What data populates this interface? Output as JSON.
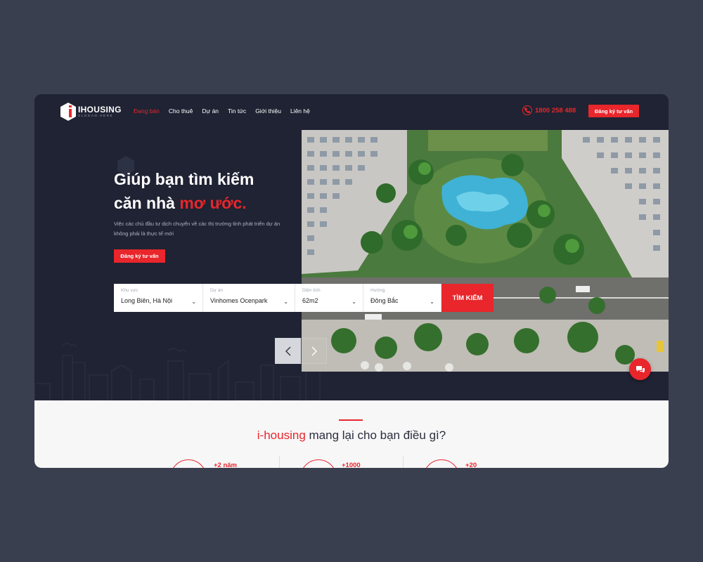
{
  "header": {
    "logo": {
      "name": "IHOUSING",
      "slogan": "SLOGAN HERE"
    },
    "nav": [
      {
        "label": "Đang bán",
        "active": true
      },
      {
        "label": "Cho thuê",
        "active": false
      },
      {
        "label": "Dự án",
        "active": false
      },
      {
        "label": "Tin tức",
        "active": false
      },
      {
        "label": "Giới thiệu",
        "active": false
      },
      {
        "label": "Liên hệ",
        "active": false
      }
    ],
    "phone": "1800 258 488",
    "cta_label": "Đăng ký tư vấn"
  },
  "hero": {
    "title_line1": "Giúp bạn tìm kiếm",
    "title_line2_prefix": "căn nhà ",
    "title_line2_accent": "mơ ước.",
    "description": "Việc các chủ đầu tư dịch chuyển về các thị trường tỉnh phát triển dự án không phải là thực tế mới",
    "cta_label": "Đăng ký tư vấn"
  },
  "search": {
    "fields": [
      {
        "label": "Khu vực",
        "value": "Long Biên, Hà Nội"
      },
      {
        "label": "Dự án",
        "value": "Vinhomes Ocenpark"
      },
      {
        "label": "Diện tích",
        "value": "62m2"
      },
      {
        "label": "Hướng",
        "value": "Đông Bắc"
      }
    ],
    "button_label": "TÌM KIẾM"
  },
  "section": {
    "title_brand": "i-housing",
    "title_rest": " mang lại cho bạn điều gì?",
    "stats": [
      "+2 năm",
      "+1000",
      "+20"
    ]
  },
  "colors": {
    "accent": "#e8262b",
    "dark_bg": "#1f2333",
    "outer_bg": "#3a3f4f"
  },
  "icons": [
    "logo-hex-icon",
    "phone-icon",
    "chevron-down-icon",
    "arrow-left-icon",
    "arrow-right-icon",
    "chat-icon"
  ]
}
